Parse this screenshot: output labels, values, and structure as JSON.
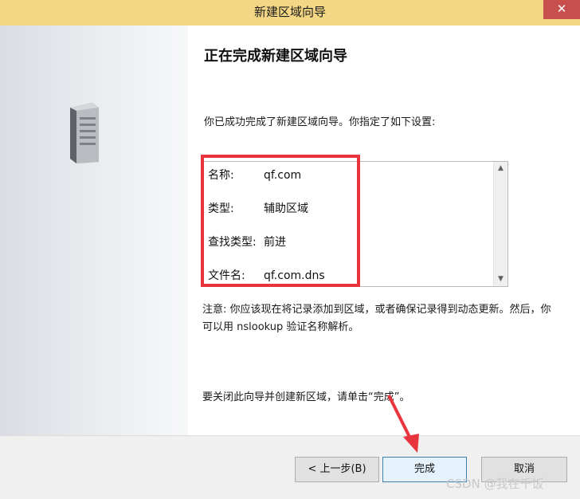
{
  "window": {
    "title": "新建区域向导",
    "close_label": "✕"
  },
  "main": {
    "heading": "正在完成新建区域向导",
    "intro": "你已成功完成了新建区域向导。你指定了如下设置:",
    "summary": [
      {
        "key": "名称:",
        "value": "qf.com"
      },
      {
        "key": "类型:",
        "value": "辅助区域"
      },
      {
        "key": "查找类型:",
        "value": "前进"
      },
      {
        "key": "文件名:",
        "value": "qf.com.dns"
      }
    ],
    "note": "注意: 你应该现在将记录添加到区域，或者确保记录得到动态更新。然后，你可以用 nslookup 验证名称解析。",
    "finish_hint": "要关闭此向导并创建新区域，请单击“完成”。"
  },
  "footer": {
    "back_label": "< 上一步(B)",
    "finish_label": "完成",
    "cancel_label": "取消"
  },
  "watermark": "CSDN @我在千饭",
  "icons": {
    "server": "server-icon",
    "scroll_up": "scroll-up-icon",
    "scroll_down": "scroll-down-icon"
  },
  "colors": {
    "titlebar": "#f4d784",
    "close": "#c7504f",
    "highlight": "#e8353d"
  }
}
